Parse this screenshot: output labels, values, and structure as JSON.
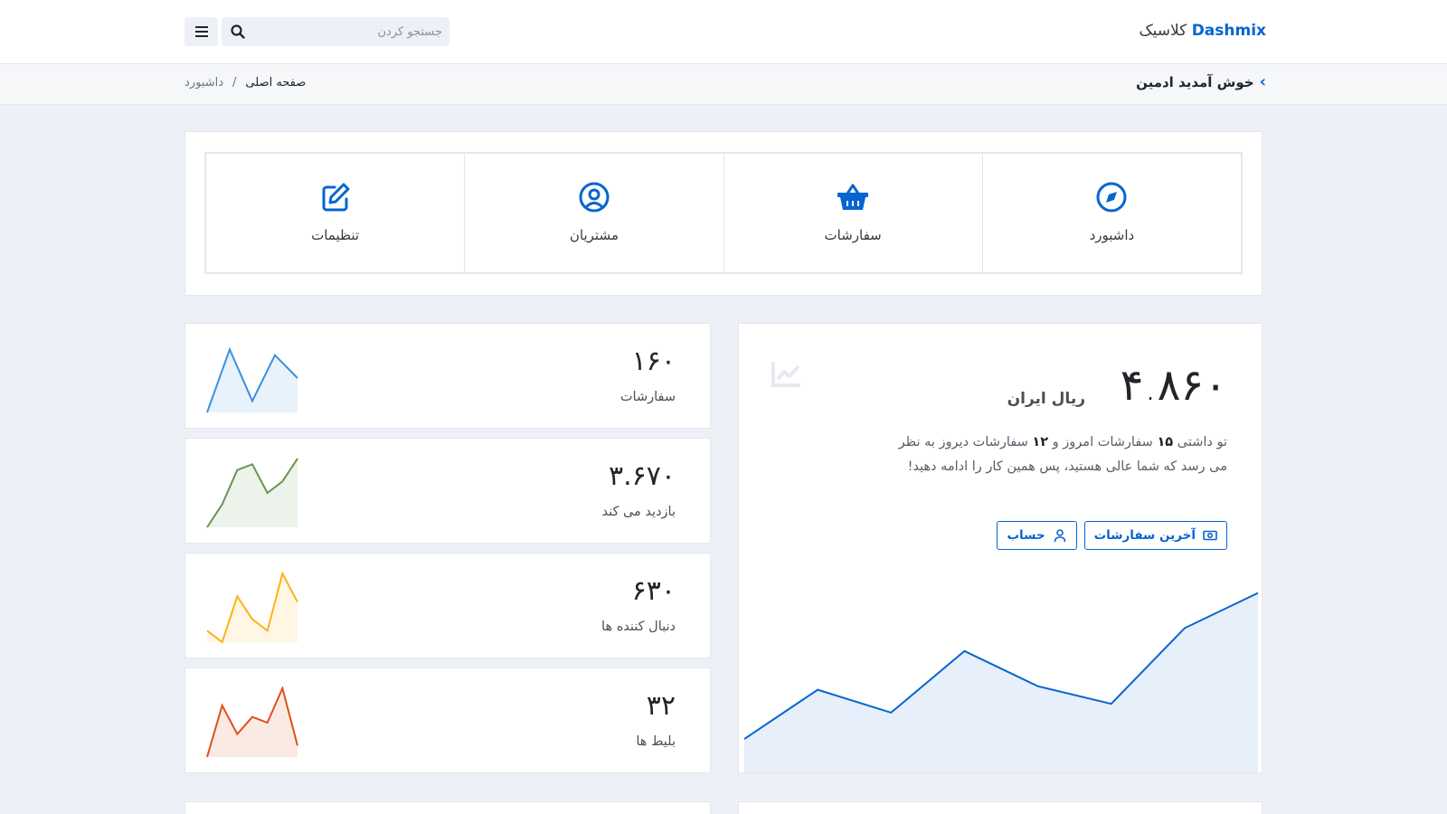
{
  "header": {
    "brand_name": "Dashmix",
    "brand_suffix": "کلاسیک",
    "search_placeholder": "جستجو کردن",
    "menu_icon": "hamburger-icon",
    "search_icon": "search-icon"
  },
  "subheader": {
    "welcome": "خوش آمدید ادمین",
    "breadcrumb": {
      "home": "صفحه اصلی",
      "separator": "/",
      "current": "داشبورد"
    }
  },
  "nav_tiles": [
    {
      "label": "داشبورد",
      "icon": "compass-icon"
    },
    {
      "label": "سفارشات",
      "icon": "basket-icon"
    },
    {
      "label": "مشتریان",
      "icon": "user-circle-icon"
    },
    {
      "label": "تنظیمات",
      "icon": "edit-icon"
    }
  ],
  "summary_card": {
    "amount": "۴.۸۶۰",
    "currency": "ریال ایران",
    "text_before": "تو داشتی",
    "today_count": "۱۵",
    "text_middle": "سفارشات امروز و",
    "yesterday_count": "۱۲",
    "text_after": "سفارشات دیروز به نظر می رسد که شما عالی هستید، پس همین کار را ادامه دهید!",
    "buttons": {
      "latest_orders": "آخرین سفارشات",
      "account": "حساب"
    },
    "accent_color": "#0665d0"
  },
  "stats": [
    {
      "value": "۱۶۰",
      "label": "سفارشات",
      "color": "#3c90df"
    },
    {
      "value": "۳.۶۷۰",
      "label": "بازدید می کند",
      "color": "#689550"
    },
    {
      "value": "۶۳۰",
      "label": "دنبال کننده ها",
      "color": "#ffb119"
    },
    {
      "value": "۳۲",
      "label": "بلیط ها",
      "color": "#e04f1a"
    }
  ],
  "chart_data": [
    {
      "type": "line",
      "name": "main-trend",
      "values": [
        20,
        48,
        35,
        70,
        50,
        40,
        83,
        103
      ],
      "ylim": [
        0,
        110
      ],
      "color": "#0665d0"
    },
    {
      "type": "line",
      "name": "orders-spark",
      "values": [
        0,
        55,
        10,
        50,
        30
      ],
      "ylim": [
        0,
        60
      ],
      "color": "#3c90df"
    },
    {
      "type": "line",
      "name": "visits-spark",
      "values": [
        0,
        20,
        50,
        55,
        30,
        40,
        60
      ],
      "ylim": [
        0,
        60
      ],
      "color": "#689550"
    },
    {
      "type": "line",
      "name": "followers-spark",
      "values": [
        10,
        0,
        40,
        20,
        10,
        60,
        35
      ],
      "ylim": [
        0,
        60
      ],
      "color": "#ffb119"
    },
    {
      "type": "line",
      "name": "tickets-spark",
      "values": [
        0,
        45,
        20,
        35,
        30,
        60,
        10
      ],
      "ylim": [
        0,
        60
      ],
      "color": "#e04f1a"
    }
  ]
}
